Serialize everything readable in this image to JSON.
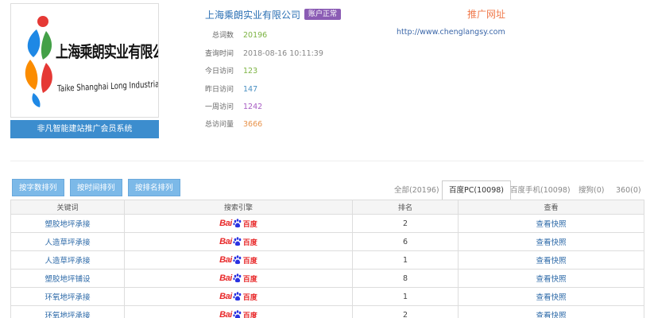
{
  "company": {
    "logo_text_cn": "上海乘朗实业有限公司",
    "logo_text_en": "Taike Shanghai Long Industrial Co., Ltd.",
    "system_label": "非凡智能建站推广会员系统",
    "name": "上海乘朗实业有限公司",
    "status": "账户正常"
  },
  "stats": [
    {
      "label": "总词数",
      "value": "20196",
      "color": "#7cb342"
    },
    {
      "label": "查询时间",
      "value": "2018-08-16 10:11:39",
      "color": "#888888"
    },
    {
      "label": "今日访问",
      "value": "123",
      "color": "#7cb342"
    },
    {
      "label": "昨日访问",
      "value": "147",
      "color": "#4a90c2"
    },
    {
      "label": "一周访问",
      "value": "1242",
      "color": "#a85cc4"
    },
    {
      "label": "总访问量",
      "value": "3666",
      "color": "#e8924a"
    }
  ],
  "promo": {
    "title": "推广网址",
    "url": "http://www.chenglangsy.com"
  },
  "sort_buttons": [
    "按字数排列",
    "按时间排列",
    "按排名排列"
  ],
  "engine_tabs": [
    {
      "label": "全部(20196)",
      "active": false
    },
    {
      "label": "百度PC(10098)",
      "active": true
    },
    {
      "label": "百度手机(10098)",
      "active": false
    },
    {
      "label": "搜狗(0)",
      "active": false
    },
    {
      "label": "360(0)",
      "active": false
    }
  ],
  "table": {
    "headers": [
      "关键词",
      "搜索引擎",
      "排名",
      "查看"
    ],
    "engine_logo": {
      "bai": "Bai",
      "du": "百度"
    },
    "rows": [
      {
        "keyword": "塑胶地坪承接",
        "rank": "2",
        "action": "查看快照"
      },
      {
        "keyword": "人造草坪承接",
        "rank": "6",
        "action": "查看快照"
      },
      {
        "keyword": "人造草坪承接",
        "rank": "1",
        "action": "查看快照"
      },
      {
        "keyword": "塑胶地坪铺设",
        "rank": "8",
        "action": "查看快照"
      },
      {
        "keyword": "环氧地坪承接",
        "rank": "1",
        "action": "查看快照"
      },
      {
        "keyword": "环氧地坪承接",
        "rank": "2",
        "action": "查看快照"
      }
    ]
  },
  "colors": {
    "accent_blue": "#3c8dce",
    "button_blue": "#7cb9e8",
    "badge_purple": "#8b5cb4",
    "promo_orange": "#f07a4c",
    "baidu_red": "#e8292a",
    "baidu_blue": "#2932e1"
  }
}
